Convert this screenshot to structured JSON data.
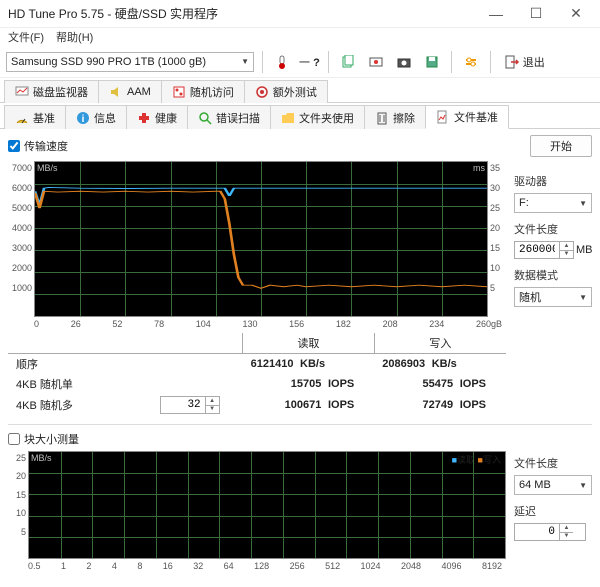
{
  "window": {
    "title": "HD Tune Pro 5.75 - 硬盘/SSD 实用程序"
  },
  "menu": {
    "file": "文件(F)",
    "help": "帮助(H)"
  },
  "toolbar": {
    "device": "Samsung SSD 990 PRO 1TB (1000 gB)",
    "temp_prefix": "一",
    "temp_value": "?",
    "exit": "退出"
  },
  "tabs": {
    "top": [
      {
        "id": "disk-monitor",
        "label": "磁盘监视器"
      },
      {
        "id": "aam",
        "label": "AAM"
      },
      {
        "id": "random-access",
        "label": "随机访问"
      },
      {
        "id": "extra-test",
        "label": "额外测试"
      }
    ],
    "bottom": [
      {
        "id": "benchmark",
        "label": "基准"
      },
      {
        "id": "info",
        "label": "信息"
      },
      {
        "id": "health",
        "label": "健康"
      },
      {
        "id": "error-scan",
        "label": "错误扫描"
      },
      {
        "id": "folder-usage",
        "label": "文件夹使用"
      },
      {
        "id": "erase",
        "label": "擦除"
      },
      {
        "id": "file-benchmark",
        "label": "文件基准",
        "active": true
      }
    ]
  },
  "controls": {
    "transfer_speed_checkbox": "传输速度",
    "start_button": "开始",
    "driver_label": "驱动器",
    "driver_value": "F:",
    "file_length_label": "文件长度",
    "file_length_value": "260000",
    "file_length_unit": "MB",
    "data_mode_label": "数据模式",
    "data_mode_value": "随机",
    "block_size_checkbox": "块大小测量",
    "file_length2_label": "文件长度",
    "file_length2_value": "64 MB",
    "delay_label": "延迟",
    "delay_value": "0"
  },
  "results": {
    "headers": {
      "read": "读取",
      "write": "写入"
    },
    "rows": [
      {
        "label": "顺序",
        "read": "6121410",
        "read_unit": "KB/s",
        "write": "2086903",
        "write_unit": "KB/s"
      },
      {
        "label": "4KB 随机单",
        "read": "15705",
        "read_unit": "IOPS",
        "write": "55475",
        "write_unit": "IOPS"
      },
      {
        "label": "4KB 随机多",
        "spinner": "32",
        "read": "100671",
        "read_unit": "IOPS",
        "write": "72749",
        "write_unit": "IOPS"
      }
    ]
  },
  "chart_data": [
    {
      "type": "line",
      "title": "",
      "ylabel_left": "MB/s",
      "ylabel_right": "ms",
      "x_unit": "gB",
      "xlim": [
        0,
        260
      ],
      "ylim_left": [
        0,
        7000
      ],
      "ylim_right": [
        0,
        35
      ],
      "x_ticks": [
        0,
        26,
        52,
        78,
        104,
        130,
        156,
        182,
        208,
        234,
        260
      ],
      "y_ticks_left": [
        1000,
        2000,
        3000,
        4000,
        5000,
        6000,
        7000
      ],
      "y_ticks_right": [
        5,
        10,
        15,
        20,
        25,
        30,
        35
      ],
      "series": [
        {
          "name": "读取",
          "color": "#3fb8ff",
          "values_approx": "roughly constant ~5800 MB/s across 0–260 gB with small dips near start and ~110 gB"
        },
        {
          "name": "写入",
          "color": "#e08020",
          "values_approx": "≈5600 MB/s from 0–104 gB, steep drop around 104–130 gB, then ≈1350 MB/s with ripples to 260 gB"
        }
      ]
    },
    {
      "type": "line",
      "title": "",
      "ylabel": "MB/s",
      "x_unit": "",
      "x_ticks": [
        0.5,
        1,
        2,
        4,
        8,
        16,
        32,
        64,
        128,
        256,
        512,
        1024,
        2048,
        4096,
        8192
      ],
      "y_ticks": [
        5,
        10,
        15,
        20,
        25
      ],
      "ylim": [
        0,
        25
      ],
      "legend": {
        "read": "读取",
        "write": "写入"
      },
      "series": []
    }
  ]
}
